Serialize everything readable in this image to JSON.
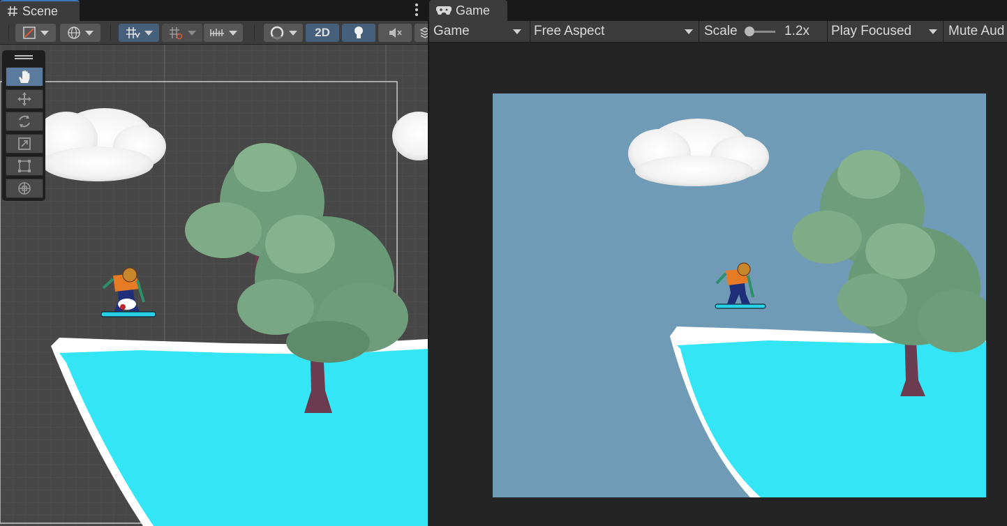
{
  "scene_tab": {
    "label": "Scene",
    "icon": "hash-icon"
  },
  "game_tab": {
    "label": "Game",
    "icon": "gamepad-icon"
  },
  "scene_toolbar": {
    "draw_mode_icon": "shading-mode-icon",
    "globe_icon": "global-icon",
    "grid_snap_icon": "grid-snap-icon",
    "increment_snap_icon": "increment-snap-icon",
    "ruler_icon": "ruler-icon",
    "gizmo_icon": "gizmo-sphere-icon",
    "mode_2d_label": "2D",
    "lighting_icon": "lightbulb-icon",
    "audio_icon": "speaker-muted-icon",
    "fx_icon": "effects-icon"
  },
  "tool_palette": [
    "hand-tool",
    "move-tool",
    "rotate-tool",
    "scale-tool",
    "rect-tool",
    "transform-tool"
  ],
  "game_toolbar": {
    "display": "Game",
    "aspect": "Free Aspect",
    "scale_label": "Scale",
    "scale_value": "1.2x",
    "scale_slider_level": 0.0,
    "play_mode": "Play Focused",
    "mute": "Mute Aud"
  },
  "colors": {
    "accent": "#3a79bb",
    "sky": "#6f9bb6",
    "snow": "#34e6f5",
    "tree": "#6f9c7a",
    "trunk": "#6b3c4f"
  }
}
